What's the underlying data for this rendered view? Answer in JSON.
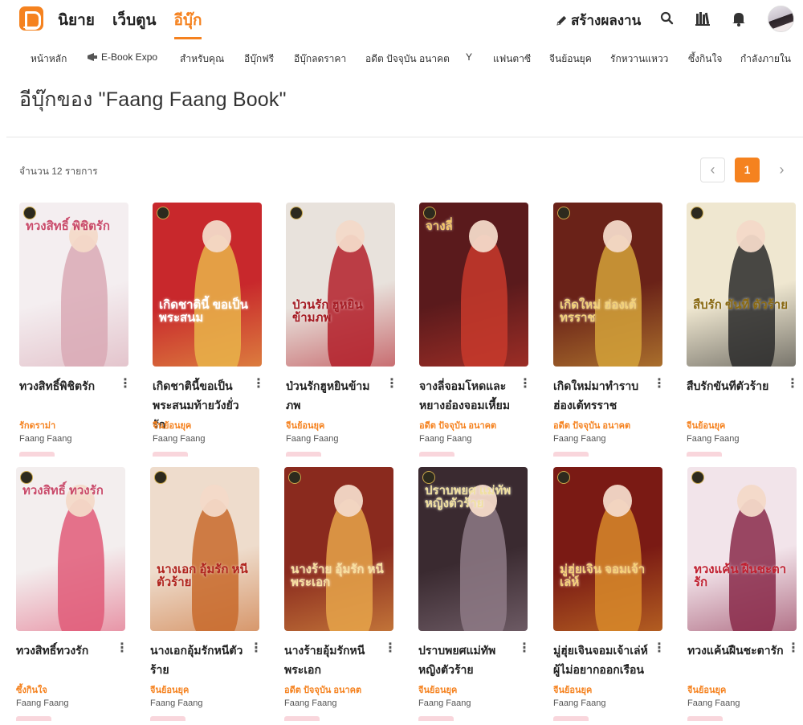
{
  "header": {
    "main_nav": [
      {
        "label": "นิยาย",
        "active": false
      },
      {
        "label": "เว็บตูน",
        "active": false
      },
      {
        "label": "อีบุ๊ก",
        "active": true
      }
    ],
    "create_label": "สร้างผลงาน",
    "icons": [
      "search-icon",
      "bookshelf-icon",
      "bell-icon"
    ]
  },
  "categories": [
    "หน้าหลัก",
    "E-Book Expo",
    "สำหรับคุณ",
    "อีบุ๊กฟรี",
    "อีบุ๊กลดราคา",
    "อดีต ปัจจุบัน อนาคต",
    "Y",
    "แฟนตาซี",
    "จีนย้อนยุค",
    "รักหวานแหวว",
    "ซึ้งกินใจ",
    "กำลังภายใน"
  ],
  "page_title": "อีบุ๊กของ \"Faang Faang Book\"",
  "count_text": "จำนวน 12 รายการ",
  "pagination": {
    "current": "1",
    "prev": "‹",
    "next": "›"
  },
  "accent_color": "#f5821f",
  "books": [
    {
      "title": "ทวงสิทธิ์พิชิตรัก",
      "genre": "รักดราม่า",
      "author": "Faang Faang",
      "cover_text": "ทวงสิทธิ์ พิชิตรัก",
      "cover_bg": "#f4eef0",
      "cover_accent": "#d9a9b5",
      "text_color": "#c94a6a"
    },
    {
      "title": "เกิดชาตินี้ขอเป็นพระสนมท้ายวังยั่วรัก",
      "genre": "จีนย้อนยุค",
      "author": "Faang Faang",
      "cover_text": "เกิดชาตินี้ ขอเป็นพระสนม",
      "cover_bg": "#c8282c",
      "cover_accent": "#e9b44a",
      "text_color": "#ffffff"
    },
    {
      "title": "ป่วนรักฮูหยินข้ามภพ",
      "genre": "จีนย้อนยุค",
      "author": "Faang Faang",
      "cover_text": "ป่วนรัก ฮูหยิน ข้ามภพ",
      "cover_bg": "#e8e2dc",
      "cover_accent": "#b3202a",
      "text_color": "#a51c24"
    },
    {
      "title": "จางลี่จอมโหดและหยางอ๋องจอมเหี้ยม",
      "genre": "อดีต ปัจจุบัน อนาคต",
      "author": "Faang Faang",
      "cover_text": "จางลี่",
      "cover_bg": "#5a1a1c",
      "cover_accent": "#c83a2c",
      "text_color": "#f5c86a"
    },
    {
      "title": "เกิดใหม่มาทำราบฮ่องเต้ทรราช",
      "genre": "อดีต ปัจจุบัน อนาคต",
      "author": "Faang Faang",
      "cover_text": "เกิดใหม่ ฮ่องเต้ทรราช",
      "cover_bg": "#6a2218",
      "cover_accent": "#d4a23a",
      "text_color": "#f3d27a"
    },
    {
      "title": "สืบรักขันทีตัวร้าย",
      "genre": "จีนย้อนยุค",
      "author": "Faang Faang",
      "cover_text": "สืบรัก ขันที ตัวร้าย",
      "cover_bg": "#efe7d0",
      "cover_accent": "#2a2a2a",
      "text_color": "#8a6a14"
    },
    {
      "title": "ทวงสิทธิ์ทวงรัก",
      "genre": "ซึ้งกินใจ",
      "author": "Faang Faang",
      "cover_text": "ทวงสิทธิ์ ทวงรัก",
      "cover_bg": "#f3eeee",
      "cover_accent": "#e05a78",
      "text_color": "#c94a6a"
    },
    {
      "title": "นางเอกอุ้มรักหนีตัวร้าย",
      "genre": "จีนย้อนยุค",
      "author": "Faang Faang",
      "cover_text": "นางเอก อุ้มรัก หนีตัวร้าย",
      "cover_bg": "#eedccc",
      "cover_accent": "#c86a2c",
      "text_color": "#b0241e"
    },
    {
      "title": "นางร้ายอุ้มรักหนีพระเอก",
      "genre": "อดีต ปัจจุบัน อนาคต",
      "author": "Faang Faang",
      "cover_text": "นางร้าย อุ้มรัก หนีพระเอก",
      "cover_bg": "#8a2a1e",
      "cover_accent": "#e6a44a",
      "text_color": "#f8e0a0"
    },
    {
      "title": "ปราบพยศแม่ทัพหญิงตัวร้าย",
      "genre": "จีนย้อนยุค",
      "author": "Faang Faang",
      "cover_text": "ปราบพยศ แม่ทัพหญิงตัวร้าย",
      "cover_bg": "#3a2a30",
      "cover_accent": "#8e7a86",
      "text_color": "#f0e0a0"
    },
    {
      "title": "มู่ฮุ่ยเจินจอมเจ้าเล่ห์ผู้ไม่อยากออกเรือน",
      "genre": "จีนย้อนยุค",
      "author": "Faang Faang",
      "cover_text": "มู่ฮุ่ยเจิน จอมเจ้าเล่ห์",
      "cover_bg": "#7a1a14",
      "cover_accent": "#d88a2a",
      "text_color": "#f6d27a"
    },
    {
      "title": "ทวงแค้นฝืนชะตารัก",
      "genre": "จีนย้อนยุค",
      "author": "Faang Faang",
      "cover_text": "ทวงแค้น ฝืนชะตารัก",
      "cover_bg": "#f2e4ea",
      "cover_accent": "#8a2a4a",
      "text_color": "#c02030"
    }
  ]
}
